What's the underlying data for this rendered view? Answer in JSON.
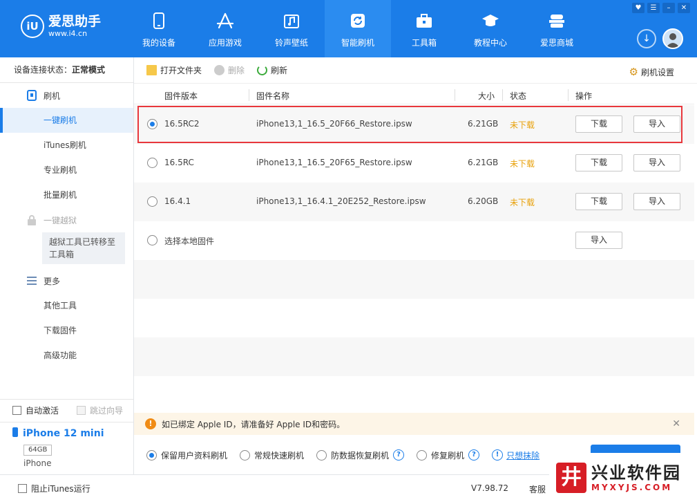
{
  "header": {
    "logo_mark": "iU",
    "logo_title": "爱思助手",
    "logo_url": "www.i4.cn",
    "nav": [
      {
        "label": "我的设备",
        "icon": "phone-icon"
      },
      {
        "label": "应用游戏",
        "icon": "app-store-icon"
      },
      {
        "label": "铃声壁纸",
        "icon": "music-wallpaper-icon"
      },
      {
        "label": "智能刷机",
        "icon": "refresh-icon"
      },
      {
        "label": "工具箱",
        "icon": "toolbox-icon"
      },
      {
        "label": "教程中心",
        "icon": "graduation-cap-icon"
      },
      {
        "label": "爱思商城",
        "icon": "store-icon"
      }
    ],
    "active_nav": "智能刷机",
    "window_controls": [
      "♥",
      "☰",
      "–",
      "✕"
    ]
  },
  "sidebar": {
    "status_label": "设备连接状态：",
    "status_value": "正常模式",
    "flash_section": "刷机",
    "flash_items": [
      "一键刷机",
      "iTunes刷机",
      "专业刷机",
      "批量刷机"
    ],
    "jailbreak_section": "一键越狱",
    "jailbreak_note": "越狱工具已转移至工具箱",
    "more_section": "更多",
    "more_items": [
      "其他工具",
      "下载固件",
      "高级功能"
    ],
    "auto_activate": "自动激活",
    "skip_guide": "跳过向导",
    "device_name": "iPhone 12 mini",
    "device_capacity": "64GB",
    "device_type": "iPhone"
  },
  "toolbar": {
    "open_folder": "打开文件夹",
    "delete": "删除",
    "refresh": "刷新",
    "settings": "刷机设置"
  },
  "table": {
    "headers": {
      "version": "固件版本",
      "name": "固件名称",
      "size": "大小",
      "status": "状态",
      "action": "操作"
    },
    "rows": [
      {
        "version": "16.5RC2",
        "name": "iPhone13,1_16.5_20F66_Restore.ipsw",
        "size": "6.21GB",
        "status": "未下载",
        "download": "下载",
        "import": "导入"
      },
      {
        "version": "16.5RC",
        "name": "iPhone13,1_16.5_20F65_Restore.ipsw",
        "size": "6.21GB",
        "status": "未下载",
        "download": "下载",
        "import": "导入"
      },
      {
        "version": "16.4.1",
        "name": "iPhone13,1_16.4.1_20E252_Restore.ipsw",
        "size": "6.20GB",
        "status": "未下载",
        "download": "下载",
        "import": "导入"
      }
    ],
    "local_label": "选择本地固件",
    "local_import": "导入"
  },
  "notice": {
    "text": "如已绑定 Apple ID，请准备好 Apple ID和密码。",
    "icon": "!"
  },
  "options": {
    "keep_data": "保留用户资料刷机",
    "quick": "常规快速刷机",
    "anti_recovery": "防数据恢复刷机",
    "repair": "修复刷机",
    "erase_link": "只想抹除"
  },
  "bottom": {
    "block_itunes": "阻止iTunes运行",
    "version": "V7.98.72",
    "service": "客服"
  },
  "watermark": {
    "mark": "井",
    "cn": "兴业软件园",
    "en": "MYXYJS.COM"
  },
  "colors": {
    "brand": "#1b7de8",
    "status": "#e8a10b",
    "highlight": "#e8373c"
  }
}
